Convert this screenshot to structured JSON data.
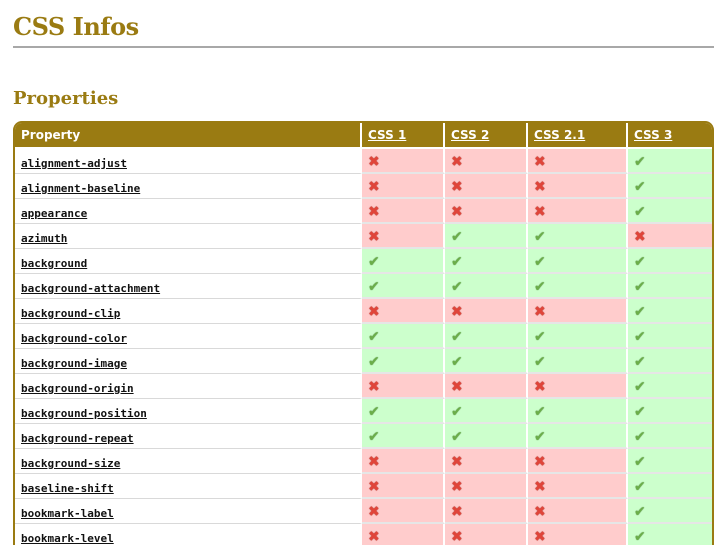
{
  "page": {
    "title": "CSS Infos",
    "section_title": "Properties"
  },
  "table": {
    "columns": [
      "Property",
      "CSS 1",
      "CSS 2",
      "CSS 2.1",
      "CSS 3"
    ],
    "rows": [
      {
        "property": "alignment-adjust",
        "support": [
          false,
          false,
          false,
          true
        ]
      },
      {
        "property": "alignment-baseline",
        "support": [
          false,
          false,
          false,
          true
        ]
      },
      {
        "property": "appearance",
        "support": [
          false,
          false,
          false,
          true
        ]
      },
      {
        "property": "azimuth",
        "support": [
          false,
          true,
          true,
          false
        ]
      },
      {
        "property": "background",
        "support": [
          true,
          true,
          true,
          true
        ]
      },
      {
        "property": "background-attachment",
        "support": [
          true,
          true,
          true,
          true
        ]
      },
      {
        "property": "background-clip",
        "support": [
          false,
          false,
          false,
          true
        ]
      },
      {
        "property": "background-color",
        "support": [
          true,
          true,
          true,
          true
        ]
      },
      {
        "property": "background-image",
        "support": [
          true,
          true,
          true,
          true
        ]
      },
      {
        "property": "background-origin",
        "support": [
          false,
          false,
          false,
          true
        ]
      },
      {
        "property": "background-position",
        "support": [
          true,
          true,
          true,
          true
        ]
      },
      {
        "property": "background-repeat",
        "support": [
          true,
          true,
          true,
          true
        ]
      },
      {
        "property": "background-size",
        "support": [
          false,
          false,
          false,
          true
        ]
      },
      {
        "property": "baseline-shift",
        "support": [
          false,
          false,
          false,
          true
        ]
      },
      {
        "property": "bookmark-label",
        "support": [
          false,
          false,
          false,
          true
        ]
      },
      {
        "property": "bookmark-level",
        "support": [
          false,
          false,
          false,
          true
        ]
      }
    ]
  },
  "icons": {
    "yes": "check-icon",
    "no": "cross-icon"
  },
  "colors": {
    "accent": "#9a7b12",
    "supported_bg": "#ccffcc",
    "unsupported_bg": "#ffcccc",
    "check": "#6cae4a",
    "cross": "#e0453a"
  }
}
